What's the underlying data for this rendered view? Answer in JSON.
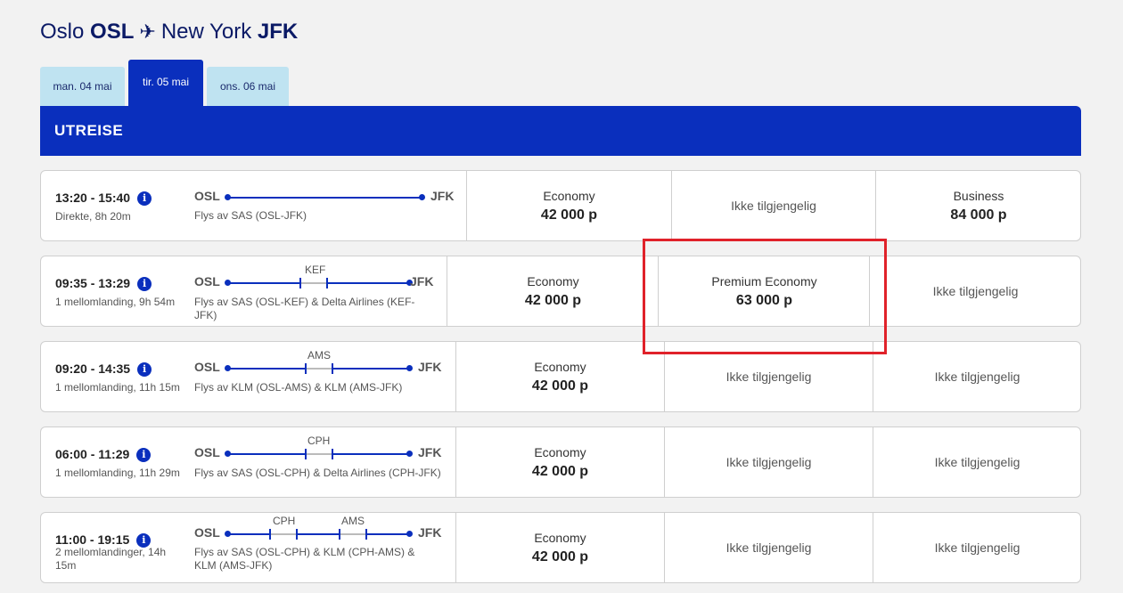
{
  "header": {
    "origin_city": "Oslo",
    "origin_code": "OSL",
    "dest_city": "New York",
    "dest_code": "JFK",
    "plane_icon": "✈"
  },
  "tabs": [
    {
      "label": "man. 04 mai"
    },
    {
      "label": "tir. 05 mai",
      "active": true
    },
    {
      "label": "ons. 06 mai"
    }
  ],
  "section": {
    "title": "UTREISE"
  },
  "flights": [
    {
      "time": "13:20 - 15:40",
      "duration": "Direkte, 8h 20m",
      "from": "OSL",
      "to": "JFK",
      "stops": [],
      "operator": "Flys av SAS (OSL-JFK)",
      "fares": [
        {
          "class": "Economy",
          "price": "42 000 p"
        },
        {
          "unavailable": "Ikke tilgjengelig"
        },
        {
          "class": "Business",
          "price": "84 000 p"
        }
      ]
    },
    {
      "time": "09:35 - 13:29",
      "duration": "1 mellomlanding, 9h 54m",
      "from": "OSL",
      "to": "JFK",
      "stops": [
        "KEF"
      ],
      "operator": "Flys av SAS (OSL-KEF) & Delta Airlines (KEF-JFK)",
      "fares": [
        {
          "class": "Economy",
          "price": "42 000 p"
        },
        {
          "class": "Premium Economy",
          "price": "63 000 p"
        },
        {
          "unavailable": "Ikke tilgjengelig"
        }
      ]
    },
    {
      "time": "09:20 - 14:35",
      "duration": "1 mellomlanding, 11h 15m",
      "from": "OSL",
      "to": "JFK",
      "stops": [
        "AMS"
      ],
      "operator": "Flys av KLM (OSL-AMS) & KLM (AMS-JFK)",
      "fares": [
        {
          "class": "Economy",
          "price": "42 000 p"
        },
        {
          "unavailable": "Ikke tilgjengelig"
        },
        {
          "unavailable": "Ikke tilgjengelig"
        }
      ]
    },
    {
      "time": "06:00 - 11:29",
      "duration": "1 mellomlanding, 11h 29m",
      "from": "OSL",
      "to": "JFK",
      "stops": [
        "CPH"
      ],
      "operator": "Flys av SAS (OSL-CPH) & Delta Airlines (CPH-JFK)",
      "fares": [
        {
          "class": "Economy",
          "price": "42 000 p"
        },
        {
          "unavailable": "Ikke tilgjengelig"
        },
        {
          "unavailable": "Ikke tilgjengelig"
        }
      ]
    },
    {
      "time": "11:00 - 19:15",
      "duration": "2 mellomlandinger, 14h 15m",
      "from": "OSL",
      "to": "JFK",
      "stops": [
        "CPH",
        "AMS"
      ],
      "operator": "Flys av SAS (OSL-CPH) & KLM (CPH-AMS) & KLM (AMS-JFK)",
      "fares": [
        {
          "class": "Economy",
          "price": "42 000 p"
        },
        {
          "unavailable": "Ikke tilgjengelig"
        },
        {
          "unavailable": "Ikke tilgjengelig"
        }
      ]
    }
  ],
  "colors": {
    "brand": "#0a2fbd",
    "tab_inactive": "#bfe3f1",
    "highlight": "#e0222a"
  }
}
